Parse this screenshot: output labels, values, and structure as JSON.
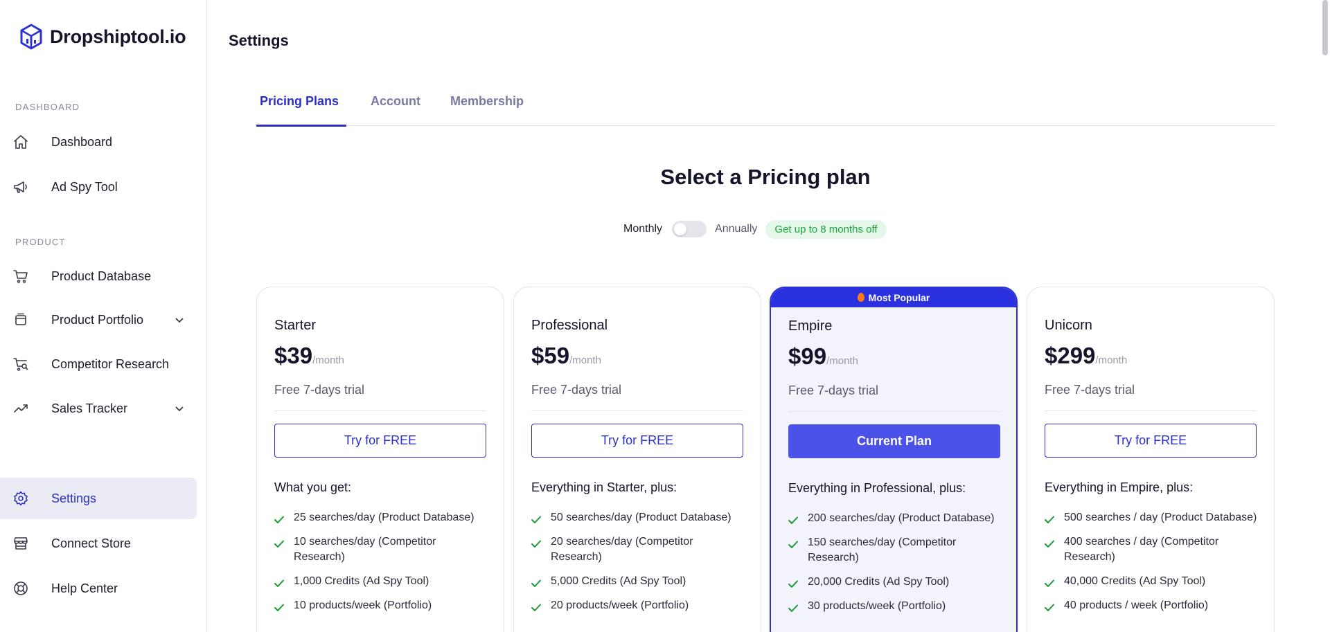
{
  "brand": {
    "name": "Dropshiptool.io"
  },
  "sidebar": {
    "sections": [
      {
        "label": "DASHBOARD"
      },
      {
        "label": "PRODUCT"
      }
    ],
    "items": [
      {
        "label": "Dashboard",
        "icon": "home-icon"
      },
      {
        "label": "Ad Spy Tool",
        "icon": "megaphone-icon"
      },
      {
        "label": "Product Database",
        "icon": "cart-icon"
      },
      {
        "label": "Product Portfolio",
        "icon": "box-icon"
      },
      {
        "label": "Competitor Research",
        "icon": "cart-search-icon"
      },
      {
        "label": "Sales Tracker",
        "icon": "trend-icon"
      },
      {
        "label": "Settings",
        "icon": "gear-icon"
      },
      {
        "label": "Connect Store",
        "icon": "store-icon"
      },
      {
        "label": "Help Center",
        "icon": "lifebuoy-icon"
      }
    ]
  },
  "page": {
    "title": "Settings"
  },
  "tabs": [
    {
      "label": "Pricing Plans",
      "active": true
    },
    {
      "label": "Account"
    },
    {
      "label": "Membership"
    }
  ],
  "pricing": {
    "heading": "Select a Pricing plan",
    "monthly_label": "Monthly",
    "annually_label": "Annually",
    "annual_billing": false,
    "badge": "Get up to 8 months off",
    "popular_label": "Most Popular",
    "per_label": "/month",
    "plans": [
      {
        "name": "Starter",
        "price": "$39",
        "trial": "Free 7-days trial",
        "button": "Try for FREE",
        "features_heading": "What you get:",
        "features": [
          "25 searches/day (Product Database)",
          "10 searches/day (Competitor Research)",
          "1,000 Credits (Ad Spy Tool)",
          "10 products/week (Portfolio)"
        ]
      },
      {
        "name": "Professional",
        "price": "$59",
        "trial": "Free 7-days trial",
        "button": "Try for FREE",
        "features_heading": "Everything in Starter, plus:",
        "features": [
          "50 searches/day (Product Database)",
          "20 searches/day (Competitor Research)",
          "5,000 Credits (Ad Spy Tool)",
          "20 products/week (Portfolio)"
        ]
      },
      {
        "name": "Empire",
        "price": "$99",
        "trial": "Free 7-days trial",
        "button": "Current Plan",
        "features_heading": "Everything in Professional, plus:",
        "features": [
          "200 searches/day (Product Database)",
          "150 searches/day (Competitor Research)",
          "20,000 Credits (Ad Spy Tool)",
          "30 products/week (Portfolio)"
        ]
      },
      {
        "name": "Unicorn",
        "price": "$299",
        "trial": "Free 7-days trial",
        "button": "Try for FREE",
        "features_heading": "Everything in Empire, plus:",
        "features": [
          "500 searches / day (Product Database)",
          "400 searches / day (Competitor Research)",
          "40,000 Credits (Ad Spy Tool)",
          "40 products / week (Portfolio)"
        ]
      }
    ]
  },
  "colors": {
    "accent": "#2c31c4",
    "current_button": "#4b52e8",
    "badge_bg": "#e5f7e8",
    "badge_text": "#1aa33c"
  }
}
